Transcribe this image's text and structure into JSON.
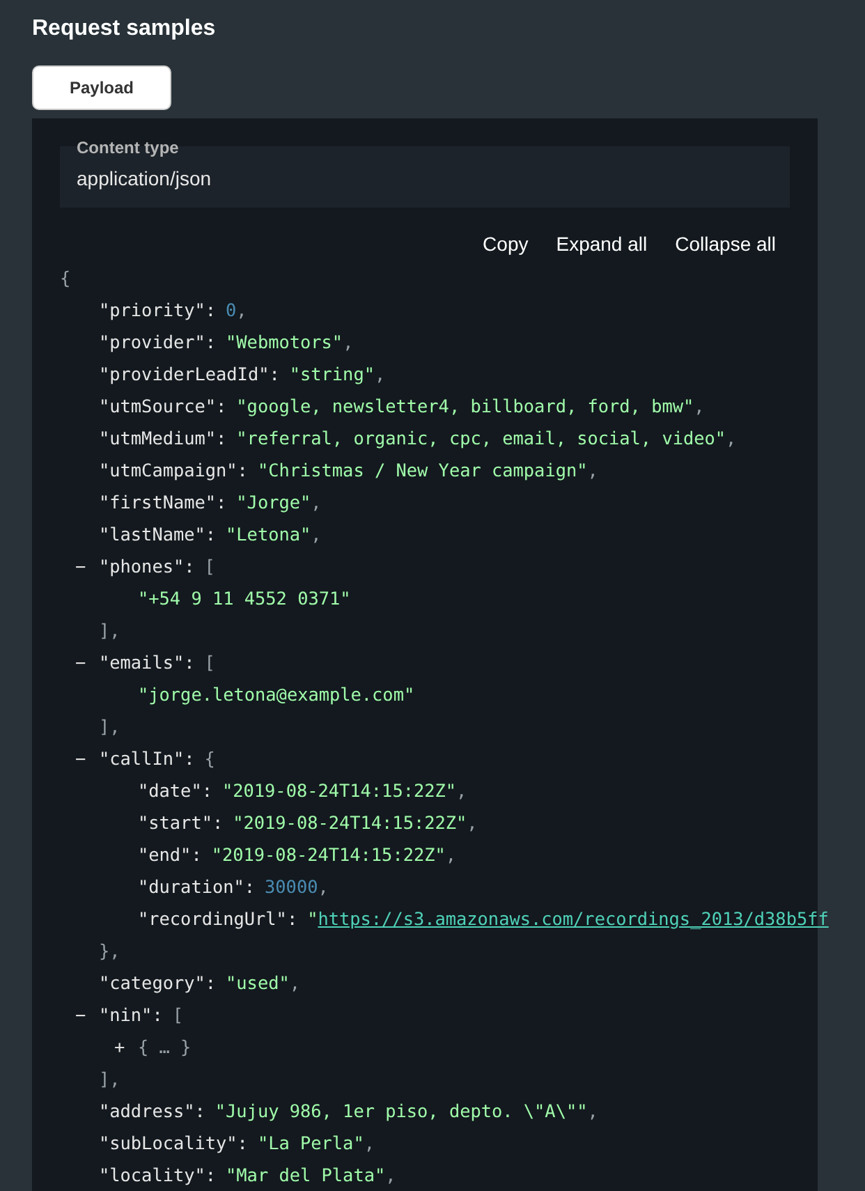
{
  "title": "Request samples",
  "tabs": [
    {
      "label": "Payload",
      "selected": true
    }
  ],
  "content_type": {
    "label": "Content type",
    "value": "application/json"
  },
  "actions": [
    "Copy",
    "Expand all",
    "Collapse all"
  ],
  "json": {
    "open": "{",
    "children": [
      {
        "key": "\"priority\":",
        "kind": "number",
        "value": "0",
        "trail": ","
      },
      {
        "key": "\"provider\":",
        "kind": "string",
        "value": "\"Webmotors\"",
        "trail": ","
      },
      {
        "key": "\"providerLeadId\":",
        "kind": "string",
        "value": "\"string\"",
        "trail": ","
      },
      {
        "key": "\"utmSource\":",
        "kind": "string",
        "value": "\"google, newsletter4, billboard, ford, bmw\"",
        "trail": ","
      },
      {
        "key": "\"utmMedium\":",
        "kind": "string",
        "value": "\"referral, organic, cpc, email, social, video\"",
        "trail": ","
      },
      {
        "key": "\"utmCampaign\":",
        "kind": "string",
        "value": "\"Christmas / New Year campaign\"",
        "trail": ","
      },
      {
        "key": "\"firstName\":",
        "kind": "string",
        "value": "\"Jorge\"",
        "trail": ","
      },
      {
        "key": "\"lastName\":",
        "kind": "string",
        "value": "\"Letona\"",
        "trail": ","
      },
      {
        "key": "\"phones\":",
        "kind": "container",
        "toggle": "−",
        "open": "[",
        "close": "],",
        "children": [
          {
            "kind": "string",
            "value": "\"+54 9 11 4552 0371\""
          }
        ]
      },
      {
        "key": "\"emails\":",
        "kind": "container",
        "toggle": "−",
        "open": "[",
        "close": "],",
        "children": [
          {
            "kind": "string",
            "value": "\"jorge.letona@example.com\""
          }
        ]
      },
      {
        "key": "\"callIn\":",
        "kind": "container",
        "toggle": "−",
        "open": "{",
        "close": "},",
        "children": [
          {
            "key": "\"date\":",
            "kind": "string",
            "value": "\"2019-08-24T14:15:22Z\"",
            "trail": ","
          },
          {
            "key": "\"start\":",
            "kind": "string",
            "value": "\"2019-08-24T14:15:22Z\"",
            "trail": ","
          },
          {
            "key": "\"end\":",
            "kind": "string",
            "value": "\"2019-08-24T14:15:22Z\"",
            "trail": ","
          },
          {
            "key": "\"duration\":",
            "kind": "number",
            "value": "30000",
            "trail": ","
          },
          {
            "key": "\"recordingUrl\":",
            "kind": "link",
            "quote": "\"",
            "value": "https://s3.amazonaws.com/recordings_2013/d38b5ff"
          }
        ]
      },
      {
        "key": "\"category\":",
        "kind": "string",
        "value": "\"used\"",
        "trail": ","
      },
      {
        "key": "\"nin\":",
        "kind": "container",
        "toggle": "−",
        "open": "[",
        "close": "],",
        "children": [
          {
            "kind": "collapsed",
            "toggle": "+",
            "value": "{ … }"
          }
        ]
      },
      {
        "key": "\"address\":",
        "kind": "string",
        "value": "\"Jujuy 986, 1er piso, depto. \\\"A\\\"\"",
        "trail": ","
      },
      {
        "key": "\"subLocality\":",
        "kind": "string",
        "value": "\"La Perla\"",
        "trail": ","
      },
      {
        "key": "\"locality\":",
        "kind": "string",
        "value": "\"Mar del Plata\"",
        "trail": ","
      }
    ]
  }
}
